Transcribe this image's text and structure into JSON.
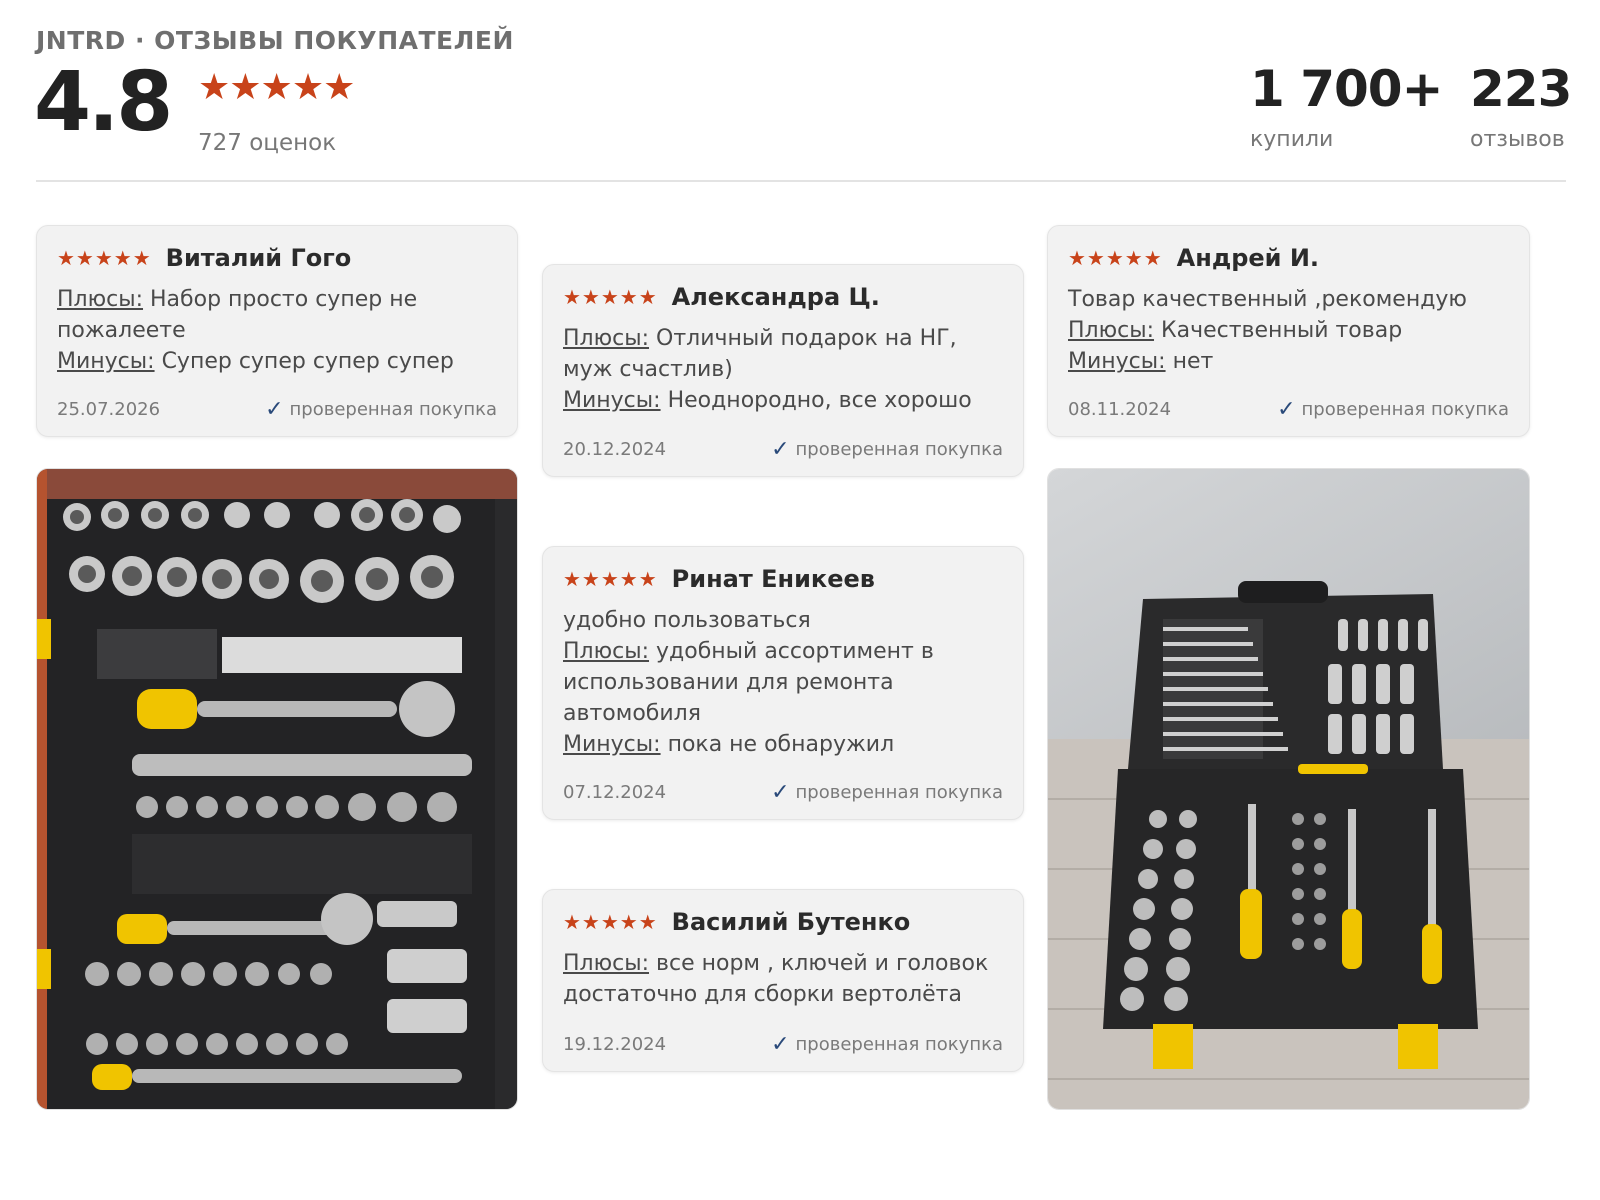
{
  "header": {
    "brand": "JNTRD · ОТЗЫВЫ ПОКУПАТЕЛЕЙ",
    "rating": "4.8",
    "rating_stars": "★★★★★",
    "ratings_count": "727 оценок",
    "bought_value": "1 700+",
    "bought_label": "купили",
    "reviews_value": "223",
    "reviews_label": "отзывов"
  },
  "labels": {
    "pros": "Плюсы:",
    "cons": "Минусы:",
    "verified": "проверенная покупка",
    "check": "✓",
    "stars": "★★★★★"
  },
  "colors": {
    "accent_star": "#c8431a",
    "verified_check": "#2a4a7a"
  },
  "reviews": [
    {
      "author": "Виталий Гого",
      "pros": "Набор просто супер не пожалеете ￼",
      "cons": "Супер супер супер супер",
      "date": "25.07.2026"
    },
    {
      "author": "Александра Ц.",
      "pros": "Отличный подарок на НГ, муж счастлив)",
      "cons": "Неоднородно, все хорошо",
      "date": "20.12.2024"
    },
    {
      "author": "Андрей И.",
      "text": "Товар качественный ,рекомендую",
      "pros": "Качественный товар",
      "cons": "нет",
      "date": "08.11.2024"
    },
    {
      "author": "Ринат Еникеев",
      "text": "удобно пользоваться",
      "pros": "удобный ассортимент в использовании для ремонта автомобиля",
      "cons": "пока не обнаружил",
      "date": "07.12.2024"
    },
    {
      "author": "Василий Бутенко",
      "pros": "все норм , ключей и головок достаточно для сборки вертолёта",
      "date": "19.12.2024"
    }
  ],
  "photos": [
    {
      "name": "tool-case-closeup-photo"
    },
    {
      "name": "tool-case-open-photo"
    }
  ]
}
